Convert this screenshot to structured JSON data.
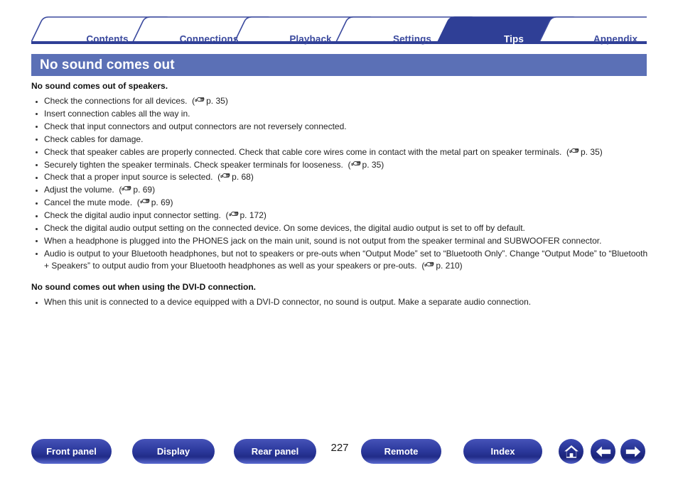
{
  "tabs": [
    {
      "label": "Contents",
      "active": false
    },
    {
      "label": "Connections",
      "active": false
    },
    {
      "label": "Playback",
      "active": false
    },
    {
      "label": "Settings",
      "active": false
    },
    {
      "label": "Tips",
      "active": true
    },
    {
      "label": "Appendix",
      "active": false
    }
  ],
  "header": {
    "title": "No sound comes out",
    "bar_color": "#5b70b6",
    "tab_color": "#3b4a9e"
  },
  "sections": [
    {
      "heading": "No sound comes out of speakers.",
      "items": [
        {
          "text": "Check the connections for all devices.",
          "ref": "p. 35"
        },
        {
          "text": "Insert connection cables all the way in.",
          "ref": ""
        },
        {
          "text": "Check that input connectors and output connectors are not reversely connected.",
          "ref": ""
        },
        {
          "text": "Check cables for damage.",
          "ref": ""
        },
        {
          "text": "Check that speaker cables are properly connected. Check that cable core wires come in contact with the metal part on speaker terminals.",
          "ref": "p. 35"
        },
        {
          "text": "Securely tighten the speaker terminals. Check speaker terminals for looseness.",
          "ref": "p. 35"
        },
        {
          "text": "Check that a proper input source is selected.",
          "ref": "p. 68"
        },
        {
          "text": "Adjust the volume.",
          "ref": "p. 69"
        },
        {
          "text": "Cancel the mute mode.",
          "ref": "p. 69"
        },
        {
          "text": "Check the digital audio input connector setting.",
          "ref": "p. 172"
        },
        {
          "text": "Check the digital audio output setting on the connected device. On some devices, the digital audio output is set to off by default.",
          "ref": ""
        },
        {
          "text": "When a headphone is plugged into the PHONES jack on the main unit, sound is not output from the speaker terminal and SUBWOOFER connector.",
          "ref": ""
        },
        {
          "text": "Audio is output to your Bluetooth headphones, but not to speakers or pre-outs when “Output Mode” set to “Bluetooth Only”. Change “Output Mode” to “Bluetooth + Speakers” to output audio from your Bluetooth headphones as well as your speakers or pre-outs.",
          "ref": "p. 210"
        }
      ]
    },
    {
      "heading": "No sound comes out when using the DVI-D connection.",
      "items": [
        {
          "text": "When this unit is connected to a device equipped with a DVI-D connector, no sound is output. Make a separate audio connection.",
          "ref": ""
        }
      ]
    }
  ],
  "footer": {
    "page_number": "227",
    "buttons": [
      {
        "label": "Front panel"
      },
      {
        "label": "Display"
      },
      {
        "label": "Rear panel"
      },
      {
        "label": "Remote"
      },
      {
        "label": "Index"
      }
    ],
    "icons": [
      {
        "name": "home-icon"
      },
      {
        "name": "back-arrow-icon"
      },
      {
        "name": "forward-arrow-icon"
      }
    ]
  }
}
